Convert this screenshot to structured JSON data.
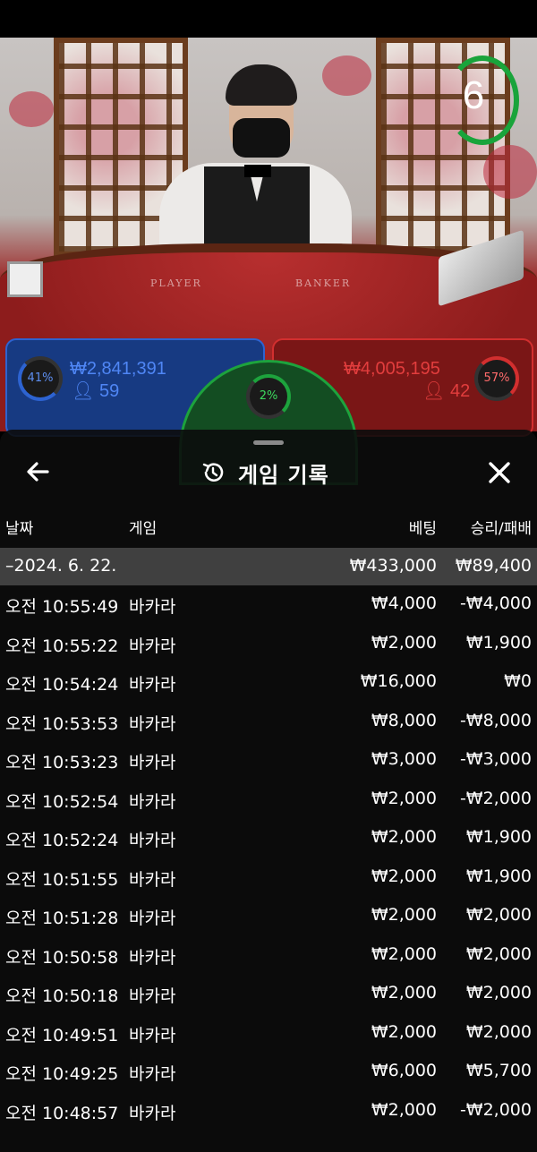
{
  "timer": {
    "seconds": "6"
  },
  "table": {
    "player_label": "PLAYER",
    "banker_label": "BANKER"
  },
  "bets": {
    "player": {
      "percent": "41%",
      "amount": "₩2,841,391",
      "count": "59"
    },
    "banker": {
      "percent": "57%",
      "amount": "₩4,005,195",
      "count": "42"
    },
    "tie": {
      "percent": "2%"
    }
  },
  "sheet": {
    "title": "게임 기록",
    "columns": {
      "date": "날짜",
      "game": "게임",
      "bet": "베팅",
      "result": "승리/패배"
    },
    "summary": {
      "date": "–2024. 6. 22.",
      "bet": "₩433,000",
      "result": "₩89,400"
    },
    "rows": [
      {
        "time": "오전 10:55:49",
        "game": "바카라",
        "bet": "₩4,000",
        "result": "-₩4,000"
      },
      {
        "time": "오전 10:55:22",
        "game": "바카라",
        "bet": "₩2,000",
        "result": "₩1,900"
      },
      {
        "time": "오전 10:54:24",
        "game": "바카라",
        "bet": "₩16,000",
        "result": "₩0"
      },
      {
        "time": "오전 10:53:53",
        "game": "바카라",
        "bet": "₩8,000",
        "result": "-₩8,000"
      },
      {
        "time": "오전 10:53:23",
        "game": "바카라",
        "bet": "₩3,000",
        "result": "-₩3,000"
      },
      {
        "time": "오전 10:52:54",
        "game": "바카라",
        "bet": "₩2,000",
        "result": "-₩2,000"
      },
      {
        "time": "오전 10:52:24",
        "game": "바카라",
        "bet": "₩2,000",
        "result": "₩1,900"
      },
      {
        "time": "오전 10:51:55",
        "game": "바카라",
        "bet": "₩2,000",
        "result": "₩1,900"
      },
      {
        "time": "오전 10:51:28",
        "game": "바카라",
        "bet": "₩2,000",
        "result": "₩2,000"
      },
      {
        "time": "오전 10:50:58",
        "game": "바카라",
        "bet": "₩2,000",
        "result": "₩2,000"
      },
      {
        "time": "오전 10:50:18",
        "game": "바카라",
        "bet": "₩2,000",
        "result": "₩2,000"
      },
      {
        "time": "오전 10:49:51",
        "game": "바카라",
        "bet": "₩2,000",
        "result": "₩2,000"
      },
      {
        "time": "오전 10:49:25",
        "game": "바카라",
        "bet": "₩6,000",
        "result": "₩5,700"
      },
      {
        "time": "오전 10:48:57",
        "game": "바카라",
        "bet": "₩2,000",
        "result": "-₩2,000"
      }
    ]
  },
  "icons": {
    "back": "arrow-left-icon",
    "close": "close-icon",
    "history": "history-icon",
    "person": "person-icon"
  },
  "colors": {
    "player": "#2d63d1",
    "banker": "#d22f2f",
    "tie": "#1da33d",
    "sheet_bg": "#0c0c0c"
  }
}
